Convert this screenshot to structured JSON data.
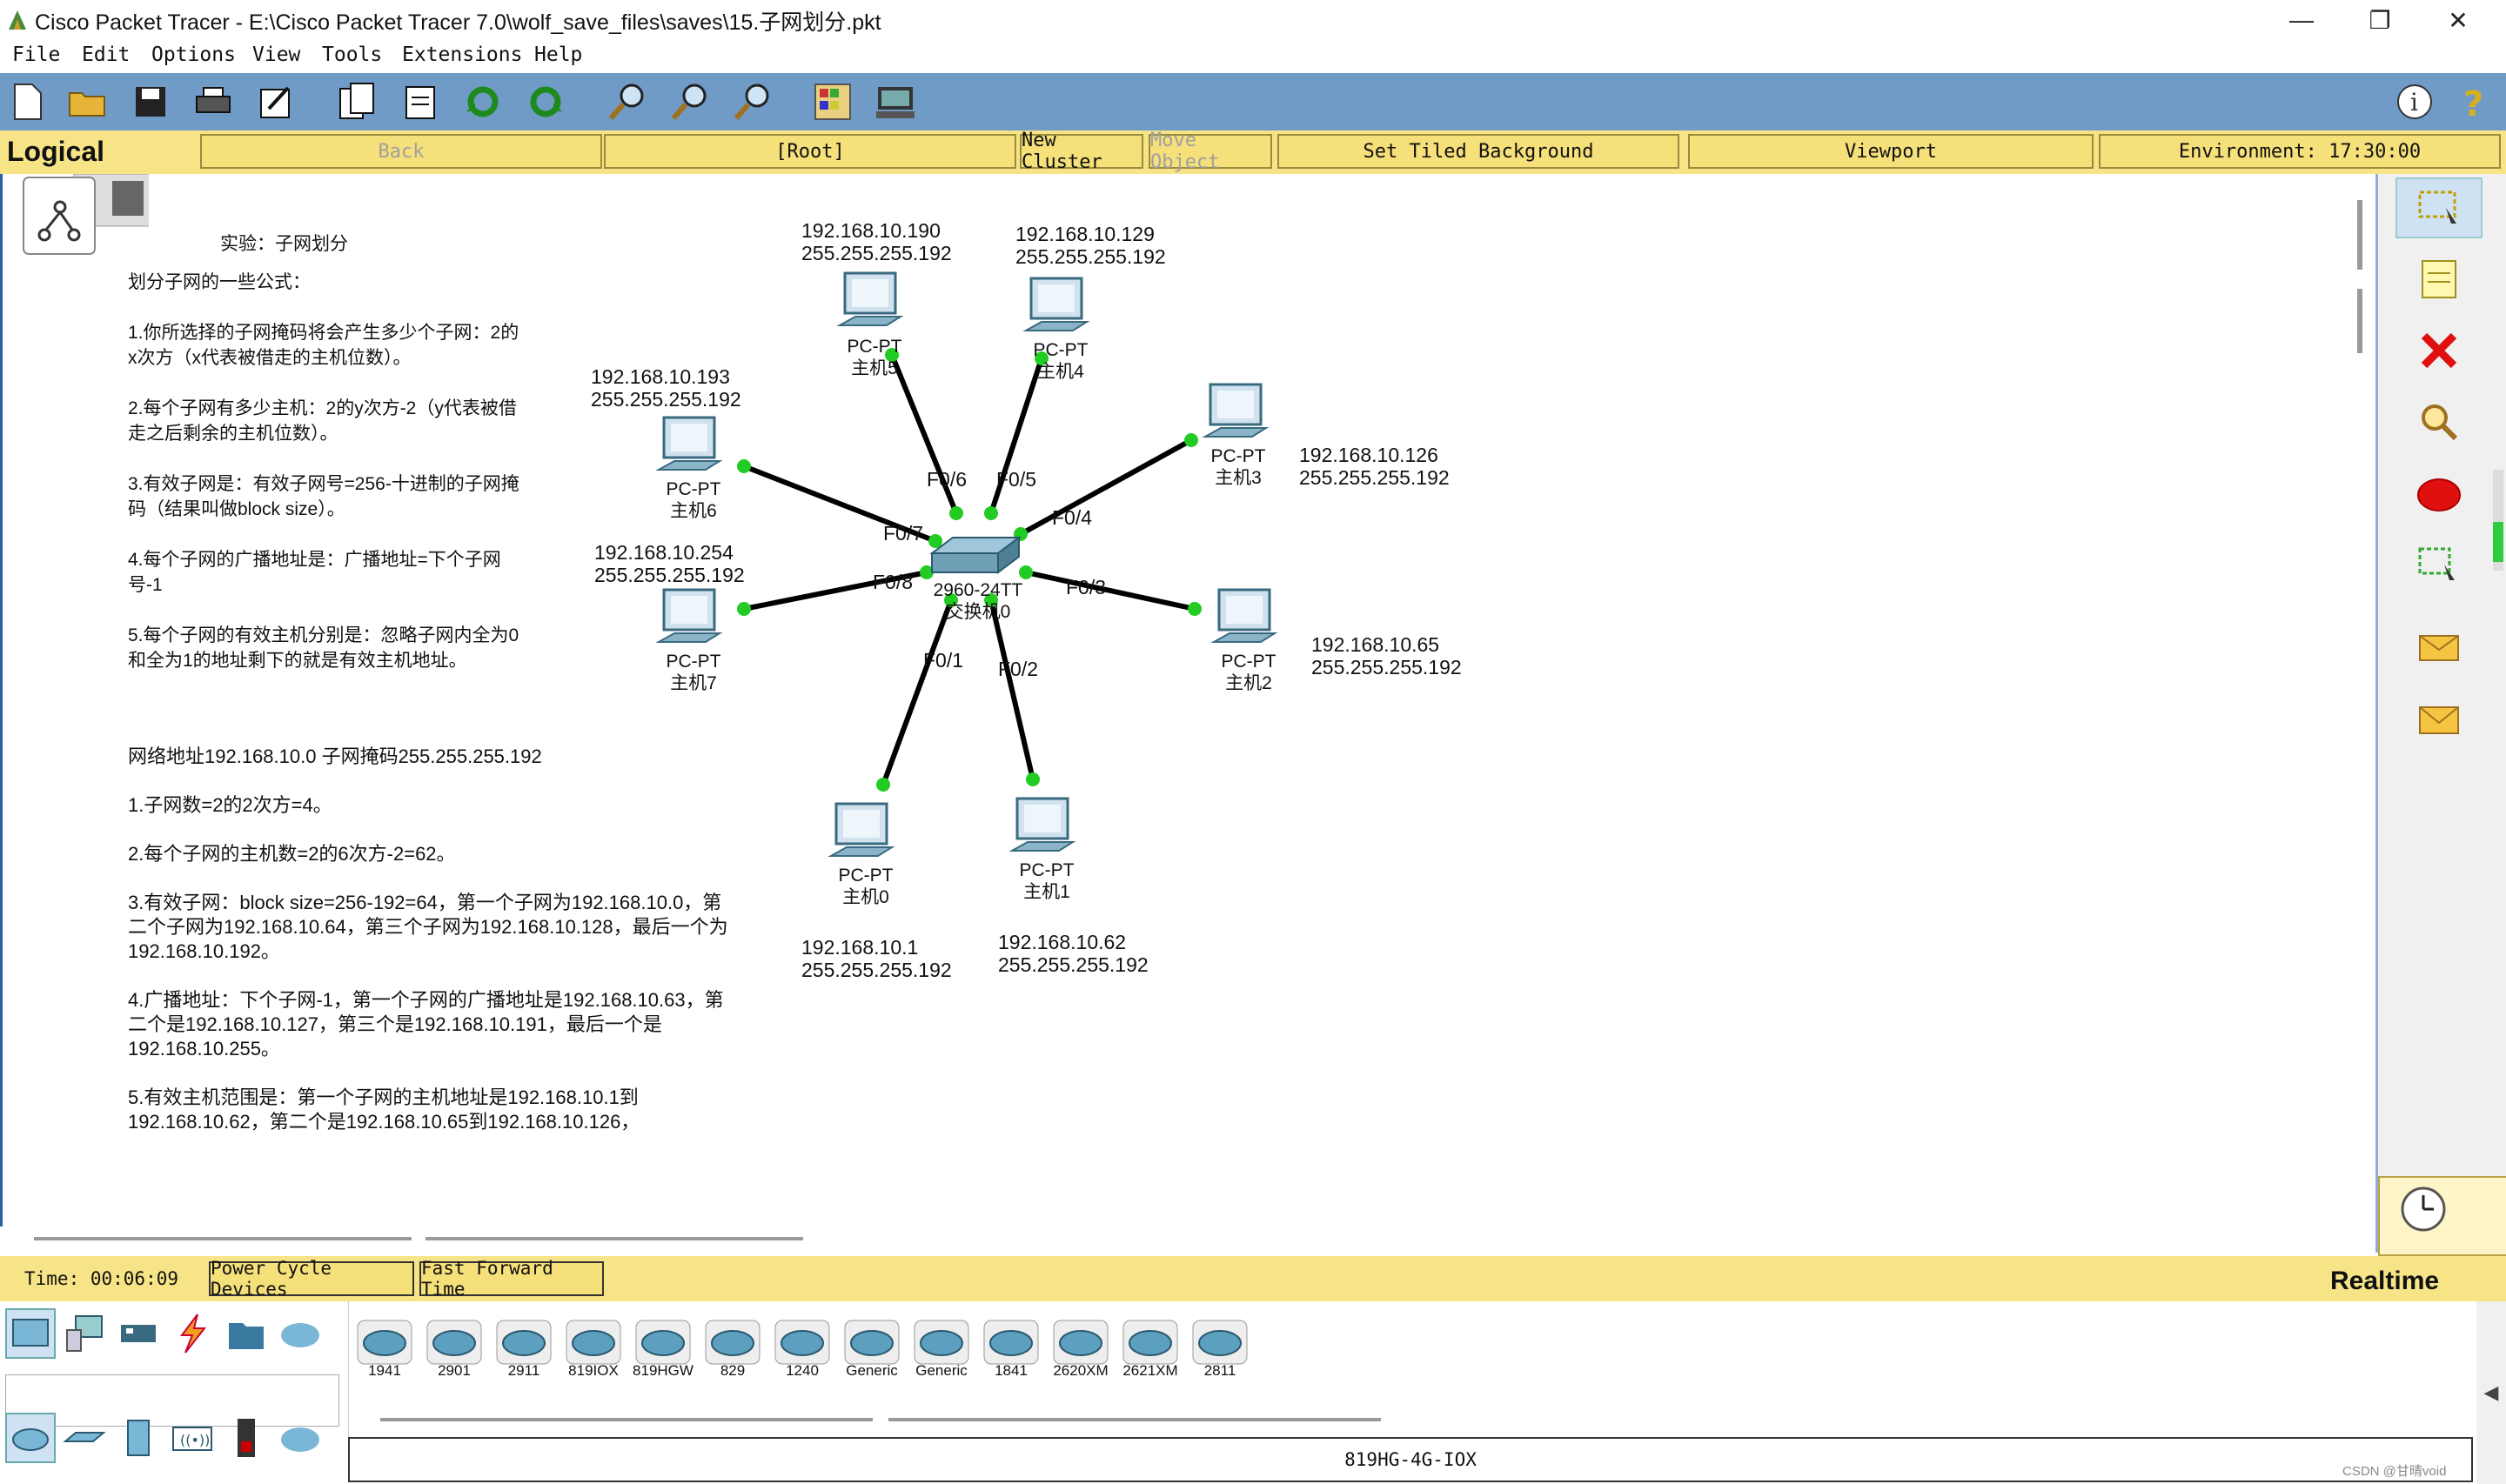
{
  "window": {
    "title": "Cisco Packet Tracer - E:\\Cisco Packet Tracer 7.0\\wolf_save_files\\saves\\15.子网划分.pkt"
  },
  "menu": [
    "File",
    "Edit",
    "Options",
    "View",
    "Tools",
    "Extensions",
    "Help"
  ],
  "nav": {
    "logical": "Logical",
    "back": "Back",
    "root": "[Root]",
    "new_cluster": "New Cluster",
    "move_object": "Move Object",
    "tiled_bg": "Set Tiled Background",
    "viewport": "Viewport",
    "environment": "Environment: 17:30:00"
  },
  "notes": {
    "title": "实验：子网划分",
    "formula": "划分子网的一些公式：\n\n1.你所选择的子网掩码将会产生多少个子网：2的x次方（x代表被借走的主机位数）。\n\n2.每个子网有多少主机：2的y次方-2（y代表被借走之后剩余的主机位数）。\n\n3.有效子网是：有效子网号=256-十进制的子网掩码（结果叫做block size）。\n\n4.每个子网的广播地址是：广播地址=下个子网号-1\n\n5.每个子网的有效主机分别是：忽略子网内全为0和全为1的地址剩下的就是有效主机地址。",
    "example": "网络地址192.168.10.0 子网掩码255.255.255.192\n\n1.子网数=2的2次方=4。\n\n2.每个子网的主机数=2的6次方-2=62。\n\n3.有效子网：block size=256-192=64，第一个子网为192.168.10.0，第二个子网为192.168.10.64，第三个子网为192.168.10.128，最后一个为192.168.10.192。\n\n4.广播地址：下个子网-1，第一个子网的广播地址是192.168.10.63，第二个是192.168.10.127，第三个是192.168.10.191，最后一个是192.168.10.255。\n\n5.有效主机范围是：第一个子网的主机地址是192.168.10.1到192.168.10.62，第二个是192.168.10.65到192.168.10.126，"
  },
  "switch": {
    "model": "2960-24TT",
    "name": "交换机0"
  },
  "pcs": [
    {
      "type": "PC-PT",
      "name": "主机5",
      "ip": "192.168.10.190",
      "mask": "255.255.255.192",
      "port": "F0/6"
    },
    {
      "type": "PC-PT",
      "name": "主机4",
      "ip": "192.168.10.129",
      "mask": "255.255.255.192",
      "port": "F0/5"
    },
    {
      "type": "PC-PT",
      "name": "主机3",
      "ip": "192.168.10.126",
      "mask": "255.255.255.192",
      "port": "F0/4"
    },
    {
      "type": "PC-PT",
      "name": "主机6",
      "ip": "192.168.10.193",
      "mask": "255.255.255.192",
      "port": "F0/7"
    },
    {
      "type": "PC-PT",
      "name": "主机7",
      "ip": "192.168.10.254",
      "mask": "255.255.255.192",
      "port": "F0/8"
    },
    {
      "type": "PC-PT",
      "name": "主机2",
      "ip": "192.168.10.65",
      "mask": "255.255.255.192",
      "port": "F0/3"
    },
    {
      "type": "PC-PT",
      "name": "主机0",
      "ip": "192.168.10.1",
      "mask": "255.255.255.192",
      "port": "F0/1"
    },
    {
      "type": "PC-PT",
      "name": "主机1",
      "ip": "192.168.10.62",
      "mask": "255.255.255.192",
      "port": "F0/2"
    }
  ],
  "status": {
    "time": "Time: 00:06:09",
    "power_cycle": "Power Cycle Devices",
    "fast_forward": "Fast Forward Time",
    "realtime": "Realtime"
  },
  "devices": [
    "1941",
    "2901",
    "2911",
    "819IOX",
    "819HGW",
    "829",
    "1240",
    "Generic",
    "Generic",
    "1841",
    "2620XM",
    "2621XM",
    "2811"
  ],
  "selected_device": "819HG-4G-IOX",
  "watermark": "CSDN @甘晴void"
}
